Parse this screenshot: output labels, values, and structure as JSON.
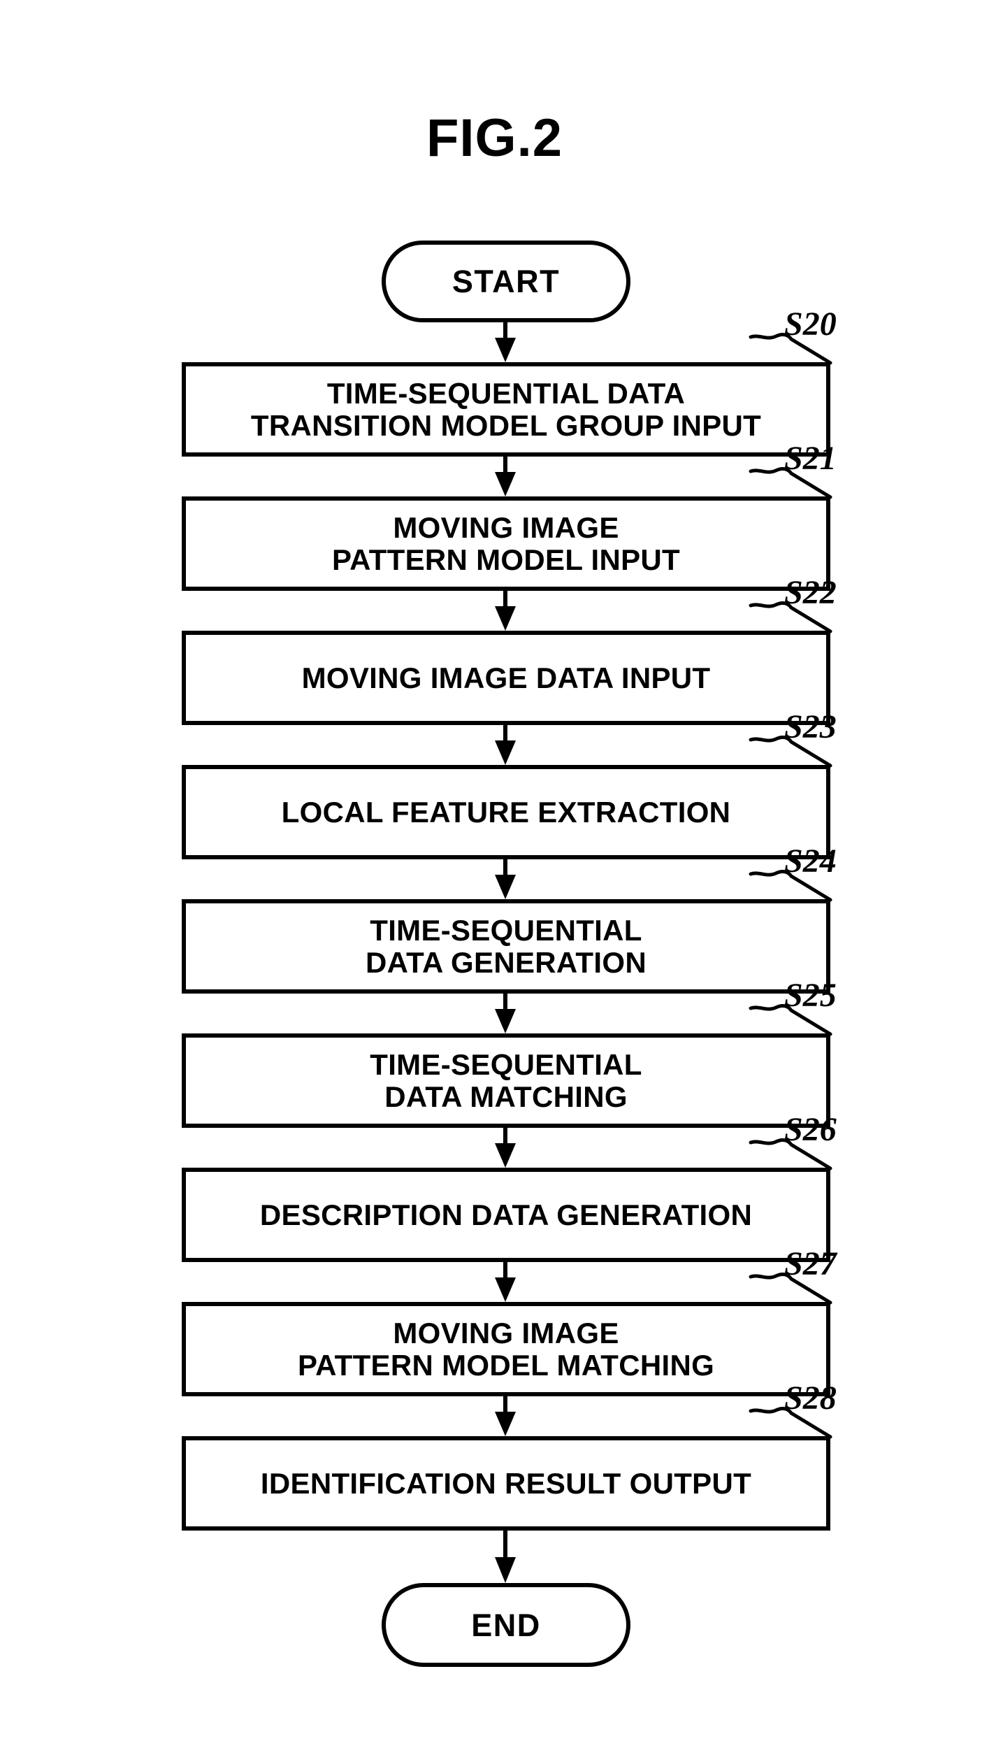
{
  "figure": {
    "title": "FIG.2"
  },
  "flowchart": {
    "start_label": "START",
    "end_label": "END",
    "steps": [
      {
        "ref": "S20",
        "text": "TIME-SEQUENTIAL DATA\nTRANSITION MODEL GROUP INPUT"
      },
      {
        "ref": "S21",
        "text": "MOVING IMAGE\nPATTERN MODEL INPUT"
      },
      {
        "ref": "S22",
        "text": "MOVING IMAGE DATA INPUT"
      },
      {
        "ref": "S23",
        "text": "LOCAL FEATURE EXTRACTION"
      },
      {
        "ref": "S24",
        "text": "TIME-SEQUENTIAL\nDATA GENERATION"
      },
      {
        "ref": "S25",
        "text": "TIME-SEQUENTIAL\nDATA MATCHING"
      },
      {
        "ref": "S26",
        "text": "DESCRIPTION DATA GENERATION"
      },
      {
        "ref": "S27",
        "text": "MOVING IMAGE\nPATTERN MODEL MATCHING"
      },
      {
        "ref": "S28",
        "text": "IDENTIFICATION RESULT OUTPUT"
      }
    ]
  },
  "colors": {
    "ink": "#000000",
    "paper": "#ffffff"
  }
}
